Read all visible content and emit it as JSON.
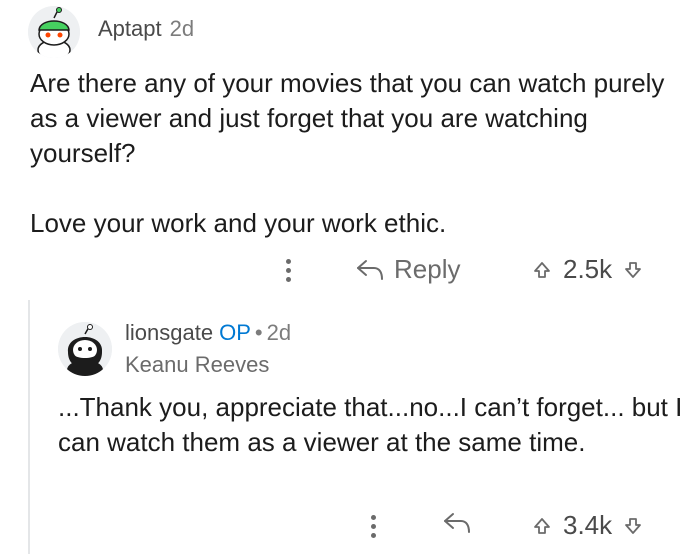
{
  "comment": {
    "username": "Aptapt",
    "time": "2d",
    "body_lines": [
      "Are there any of your movies that you can watch purely as a viewer and just forget that you are watching yourself?",
      "Love your work and your work ethic."
    ],
    "actions": {
      "reply_label": "Reply",
      "score": "2.5k"
    },
    "avatar_icon": "snoo-avatar-icon"
  },
  "reply": {
    "username": "lionsgate",
    "op_badge": "OP",
    "separator": "•",
    "time": "2d",
    "flair": "Keanu Reeves",
    "body": "...Thank you, appreciate that...no...I can’t forget... but I can watch them as a viewer at the same time.",
    "actions": {
      "score": "3.4k"
    },
    "avatar_icon": "bearded-avatar-icon"
  },
  "colors": {
    "op_blue": "#0079d3",
    "meta_gray": "#7c7c7c",
    "text": "#1c1c1c"
  }
}
